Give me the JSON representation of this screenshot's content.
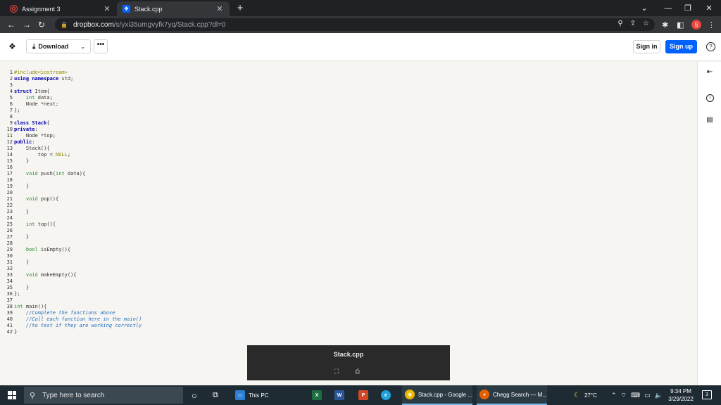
{
  "browser": {
    "tabs": [
      {
        "title": "Assignment 3",
        "icon": "assignment-favicon"
      },
      {
        "title": "Stack.cpp",
        "icon": "dropbox-favicon"
      }
    ],
    "new_tab": "+",
    "url_host": "dropbox.com",
    "url_path": "/s/yxi35umgvyfk7yq/Stack.cpp?dl=0",
    "profile_initial": "S"
  },
  "dropbox": {
    "download_label": "Download",
    "more_label": "•••",
    "signin_label": "Sign in",
    "signup_label": "Sign up",
    "help_label": "?"
  },
  "code_lines": [
    {
      "n": "1",
      "html": "<span class=\"pp\">#include&lt;iostream&gt;</span>"
    },
    {
      "n": "2",
      "html": "<span class=\"kw\">using namespace</span> std;"
    },
    {
      "n": "3",
      "html": ""
    },
    {
      "n": "4",
      "html": "<span class=\"kw\">struct</span> Item{"
    },
    {
      "n": "5",
      "html": "    <span class=\"ty\">int</span> data;"
    },
    {
      "n": "6",
      "html": "    Node *next;"
    },
    {
      "n": "7",
      "html": "};"
    },
    {
      "n": "8",
      "html": ""
    },
    {
      "n": "9",
      "html": "<span class=\"kw\">class</span> <span class=\"kw\">Stack</span>{"
    },
    {
      "n": "10",
      "html": "<span class=\"kw\">private</span>:"
    },
    {
      "n": "11",
      "html": "    Node *top;"
    },
    {
      "n": "12",
      "html": "<span class=\"kw\">public</span>:"
    },
    {
      "n": "13",
      "html": "    Stack(){"
    },
    {
      "n": "14",
      "html": "        top = <span class=\"nm\">NULL</span>;"
    },
    {
      "n": "15",
      "html": "    }"
    },
    {
      "n": "16",
      "html": ""
    },
    {
      "n": "17",
      "html": "    <span class=\"ty\">void</span> push(<span class=\"ty\">int</span> data){"
    },
    {
      "n": "18",
      "html": ""
    },
    {
      "n": "19",
      "html": "    }"
    },
    {
      "n": "20",
      "html": ""
    },
    {
      "n": "21",
      "html": "    <span class=\"ty\">void</span> pop(){"
    },
    {
      "n": "22",
      "html": ""
    },
    {
      "n": "23",
      "html": "    }"
    },
    {
      "n": "24",
      "html": ""
    },
    {
      "n": "25",
      "html": "    <span class=\"ty\">int</span> top(){"
    },
    {
      "n": "26",
      "html": ""
    },
    {
      "n": "27",
      "html": "    }"
    },
    {
      "n": "28",
      "html": ""
    },
    {
      "n": "29",
      "html": "    <span class=\"ty\">bool</span> isEmpty(){"
    },
    {
      "n": "30",
      "html": ""
    },
    {
      "n": "31",
      "html": "    }"
    },
    {
      "n": "32",
      "html": ""
    },
    {
      "n": "33",
      "html": "    <span class=\"ty\">void</span> makeEmpty(){"
    },
    {
      "n": "34",
      "html": ""
    },
    {
      "n": "35",
      "html": "    }"
    },
    {
      "n": "36",
      "html": "};"
    },
    {
      "n": "37",
      "html": ""
    },
    {
      "n": "38",
      "html": "<span class=\"ty\">int</span> main(){"
    },
    {
      "n": "39",
      "html": "    <span class=\"cm\">//Complete the functions above</span>"
    },
    {
      "n": "40",
      "html": "    <span class=\"cm\">//Call each function here in the main()</span>"
    },
    {
      "n": "41",
      "html": "    <span class=\"cm\">//to test if they are working correctly</span>"
    },
    {
      "n": "42",
      "html": "}"
    }
  ],
  "preview": {
    "filename": "Stack.cpp"
  },
  "taskbar": {
    "search_placeholder": "Type here to search",
    "apps": [
      {
        "label": "This PC"
      },
      {
        "label": "Stack.cpp - Google ..."
      },
      {
        "label": "Chegg Search — M..."
      }
    ],
    "weather": "27°C",
    "time": "9:34 PM",
    "date": "3/29/2022",
    "notifications": "3"
  },
  "colors": {
    "chrome_dark": "#202124",
    "dropbox_blue": "#0061fe",
    "taskbar": "#1f2b33"
  }
}
